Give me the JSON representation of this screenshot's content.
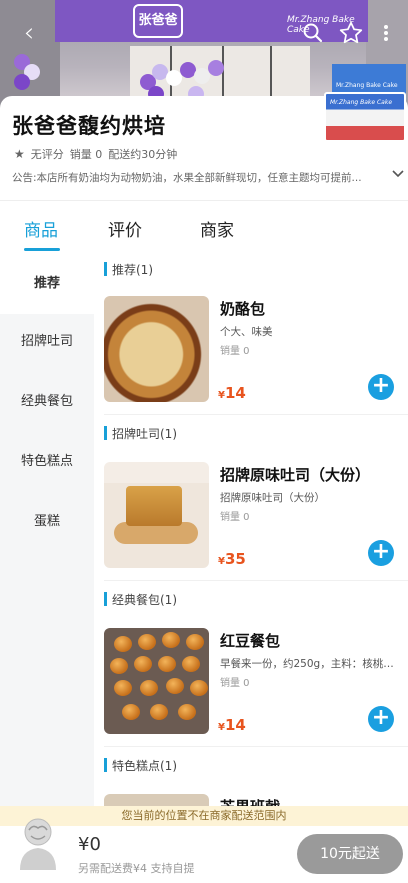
{
  "hero": {
    "sign_logo_text": "张爸爸",
    "sign_english": "Mr.Zhang Bake Cake",
    "mini_sign": "Mr.Zhang Bake Cake"
  },
  "nav": {
    "back_glyph": "‹",
    "icons": [
      "back-icon",
      "search-icon",
      "star-icon",
      "more-icon"
    ]
  },
  "store": {
    "name": "张爸爸馥约烘培",
    "rating": "无评分",
    "sales": "销量 0",
    "delivery_time": "配送约30分钟",
    "announcement": "公告:本店所有奶油均为动物奶油，水果全部新鲜现切，任意主题均可提前..."
  },
  "tabs": [
    {
      "label": "商品",
      "active": true
    },
    {
      "label": "评价",
      "active": false
    },
    {
      "label": "商家",
      "active": false
    }
  ],
  "menu": [
    {
      "label": "推荐",
      "active": true
    },
    {
      "label": "招牌吐司",
      "active": false
    },
    {
      "label": "经典餐包",
      "active": false
    },
    {
      "label": "特色糕点",
      "active": false
    },
    {
      "label": "蛋糕",
      "active": false
    }
  ],
  "sections": [
    {
      "title": "推荐(1)",
      "product": {
        "name": "奶酪包",
        "desc": "个大、味美",
        "sales": "销量 0",
        "currency": "¥",
        "price": "14"
      }
    },
    {
      "title": "招牌吐司(1)",
      "product": {
        "name": "招牌原味吐司（大份）",
        "desc": "招牌原味吐司（大份）",
        "sales": "销量 0",
        "currency": "¥",
        "price": "35"
      }
    },
    {
      "title": "经典餐包(1)",
      "product": {
        "name": "红豆餐包",
        "desc": "早餐来一份，约250g，主料：核桃、...",
        "sales": "销量 0",
        "currency": "¥",
        "price": "14"
      }
    },
    {
      "title": "特色糕点(1)",
      "product": {
        "name": "芒果班戟"
      }
    }
  ],
  "add_glyph": "+",
  "notice": "您当前的位置不在商家配送范围内",
  "cart": {
    "total": "¥0",
    "delivery_note": "另需配送费¥4  支持自提",
    "min_order_label": "10元起送"
  },
  "colors": {
    "accent": "#18a0d8",
    "price": "#e8541e",
    "sign_purple": "#7e57c2",
    "notice_bg": "#fdf3d6"
  }
}
